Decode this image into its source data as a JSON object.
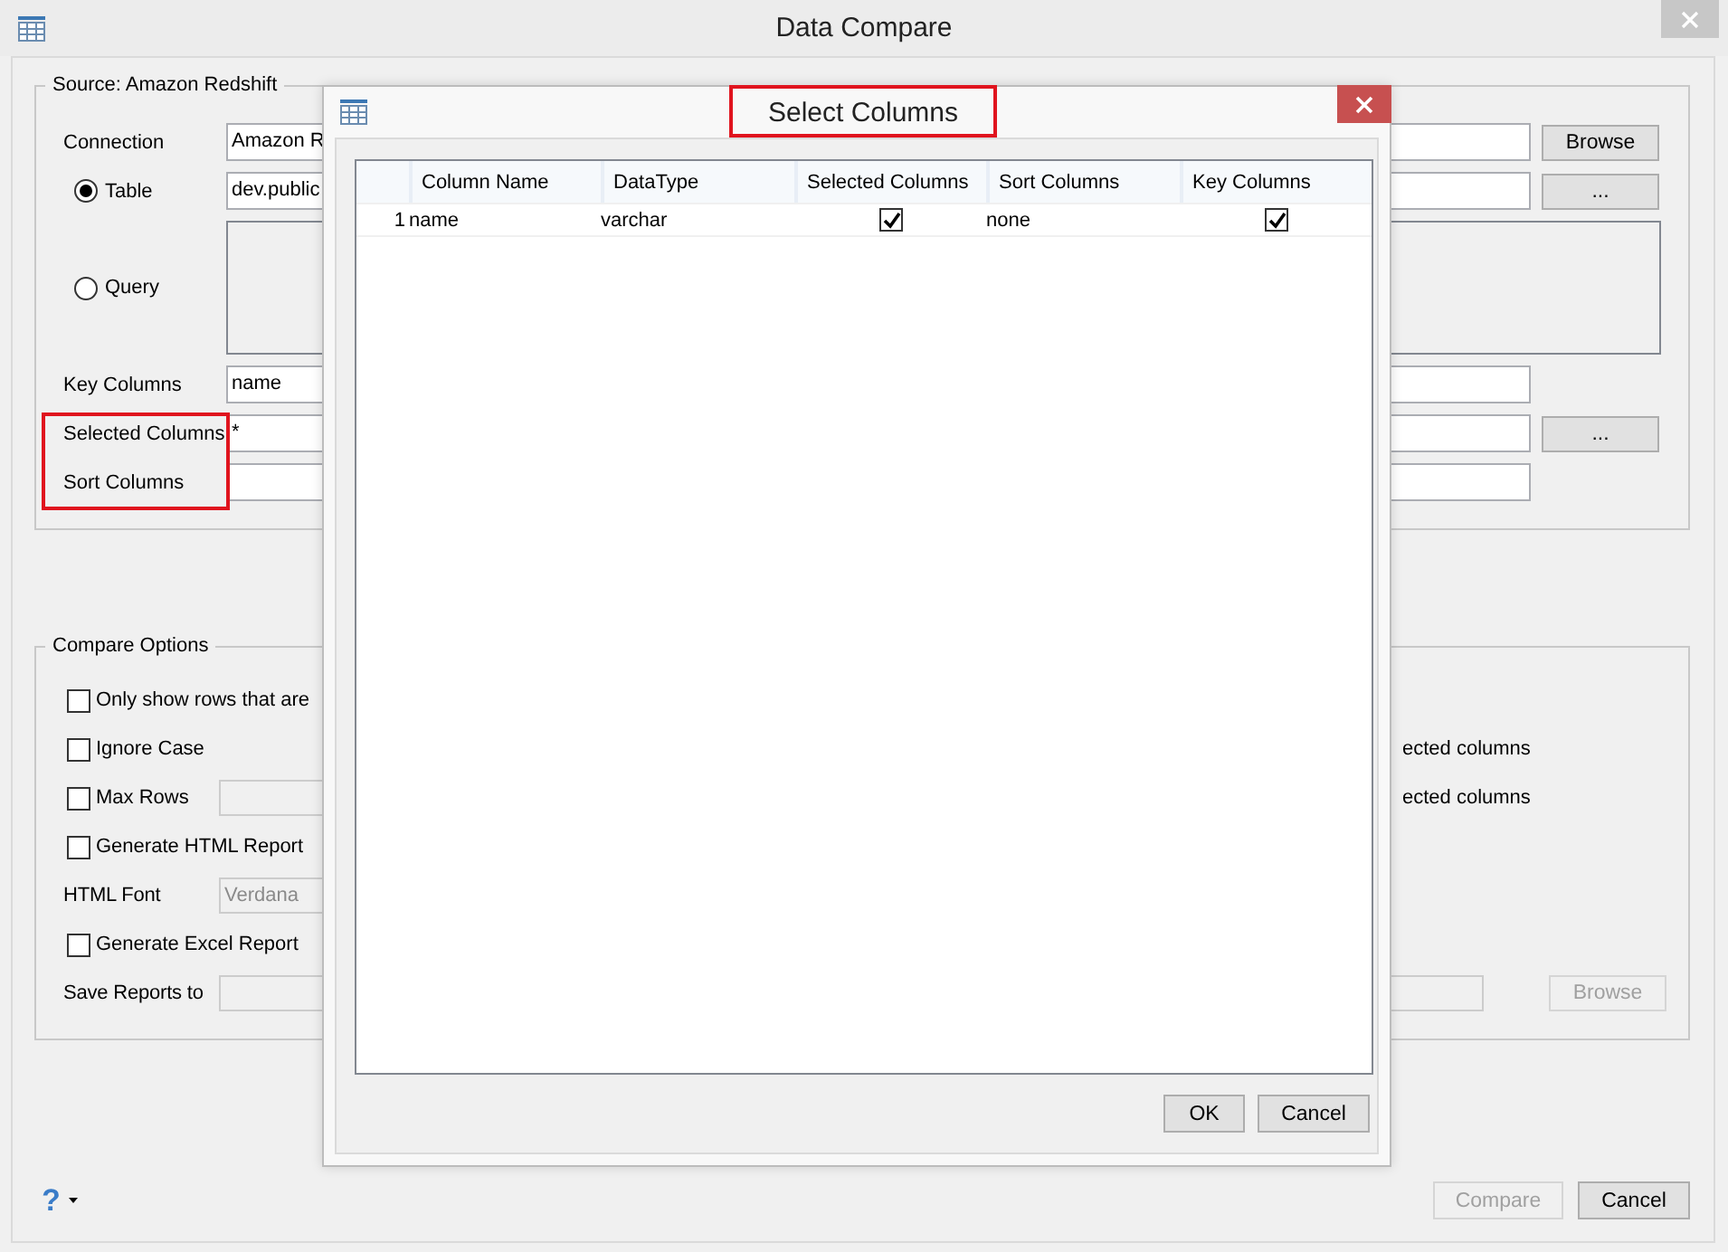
{
  "window": {
    "title": "Data Compare"
  },
  "source": {
    "legend": "Source: Amazon Redshift",
    "labels_highlighted": true,
    "rows": [
      {
        "kind": "field",
        "label": "Connection",
        "value": "Amazon R",
        "button": "Browse"
      },
      {
        "kind": "radio-field",
        "label": "Table",
        "selected": true,
        "value": "dev.public",
        "button": "..."
      },
      {
        "kind": "radio-area",
        "label": "Query",
        "selected": false
      },
      {
        "kind": "field",
        "label": "Key Columns",
        "value": "name"
      },
      {
        "kind": "field",
        "label": "Selected Columns",
        "value": "*",
        "button": "..."
      },
      {
        "kind": "field",
        "label": "Sort Columns"
      }
    ]
  },
  "compare_options": {
    "legend": "Compare Options",
    "rows": [
      {
        "kind": "checkbox",
        "label": "Only show rows that are",
        "checked": false
      },
      {
        "kind": "checkbox",
        "label": "Ignore Case",
        "checked": false,
        "right_text": "ected columns"
      },
      {
        "kind": "checkbox-field",
        "label": "Max Rows",
        "checked": false,
        "field_disabled": true,
        "right_text": "ected columns"
      },
      {
        "kind": "checkbox",
        "label": "Generate HTML Report",
        "checked": false
      },
      {
        "kind": "label-field",
        "label": "HTML Font",
        "value": "Verdana",
        "field_disabled": true
      },
      {
        "kind": "checkbox",
        "label": "Generate Excel Report",
        "checked": false
      },
      {
        "kind": "label-field",
        "label": "Save Reports to",
        "field_disabled": true,
        "button": "Browse",
        "button_disabled": true
      }
    ]
  },
  "footer": {
    "help": "?",
    "buttons": [
      {
        "label": "Compare",
        "disabled": true
      },
      {
        "label": "Cancel",
        "disabled": false
      }
    ]
  },
  "dialog": {
    "title": "Select Columns",
    "title_highlighted": true,
    "table": {
      "columns": [
        "Column Name",
        "DataType",
        "Selected Columns",
        "Sort Columns",
        "Key Columns"
      ],
      "rows": [
        {
          "number": "1",
          "column_name": "name",
          "data_type": "varchar",
          "selected_column": true,
          "sort": "none",
          "key_column": true
        }
      ]
    },
    "buttons": [
      "OK",
      "Cancel"
    ]
  }
}
